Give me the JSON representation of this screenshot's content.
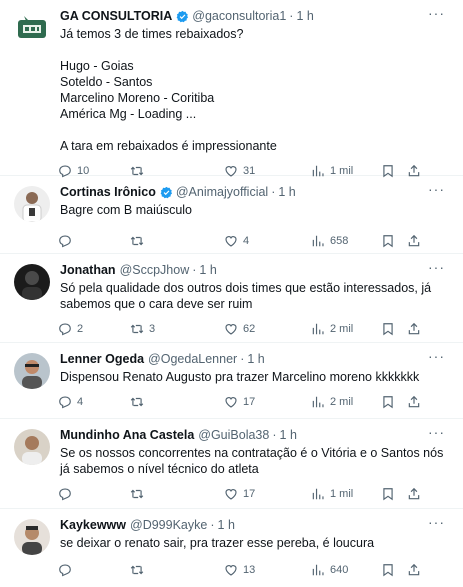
{
  "tweets": [
    {
      "name": "GA CONSULTORIA",
      "verified": true,
      "handle": "@gaconsultoria1",
      "time": "1 h",
      "text": "Já temos 3 de times rebaixados?\n\nHugo - Goias\nSoteldo - Santos\nMarcelino Moreno - Coritiba\nAmérica Mg - Loading ...\n\nA tara em rebaixados é impressionante",
      "replies": "10",
      "retweets": "",
      "likes": "31",
      "views": "1 mil"
    },
    {
      "name": "Cortinas Irônico",
      "verified": true,
      "handle": "@Animajyofficial",
      "time": "1 h",
      "text": "Bagre com B maiúsculo",
      "replies": "",
      "retweets": "",
      "likes": "4",
      "views": "658"
    },
    {
      "name": "Jonathan",
      "verified": false,
      "handle": "@SccpJhow",
      "time": "1 h",
      "text": "Só pela qualidade dos outros dois times que estão interessados, já sabemos que o cara deve ser ruim",
      "replies": "2",
      "retweets": "3",
      "likes": "62",
      "views": "2 mil"
    },
    {
      "name": "Lenner Ogeda",
      "verified": false,
      "handle": "@OgedaLenner",
      "time": "1 h",
      "text": "Dispensou Renato Augusto pra trazer Marcelino moreno kkkkkkk",
      "replies": "4",
      "retweets": "",
      "likes": "17",
      "views": "2 mil"
    },
    {
      "name": "Mundinho Ana Castela",
      "verified": false,
      "handle": "@GuiBola38",
      "time": "1 h",
      "text": "Se os nossos concorrentes na contratação é o Vitória e o Santos nós já sabemos o nível técnico do atleta",
      "replies": "",
      "retweets": "",
      "likes": "17",
      "views": "1 mil"
    },
    {
      "name": "Kaykewww",
      "verified": false,
      "handle": "@D999Kayke",
      "time": "1 h",
      "text": "se deixar o renato sair, pra trazer esse pereba, é loucura",
      "replies": "",
      "retweets": "",
      "likes": "13",
      "views": "640"
    }
  ],
  "icons": {
    "reply": "reply-icon",
    "retweet": "retweet-icon",
    "like": "heart-icon",
    "views": "views-icon",
    "bookmark": "bookmark-icon",
    "share": "share-icon",
    "more": "more-icon",
    "verified": "verified-badge-icon"
  },
  "colors": {
    "text": "#0f1419",
    "muted": "#536471",
    "verified": "#1d9bf0",
    "divider": "#eff3f4"
  }
}
